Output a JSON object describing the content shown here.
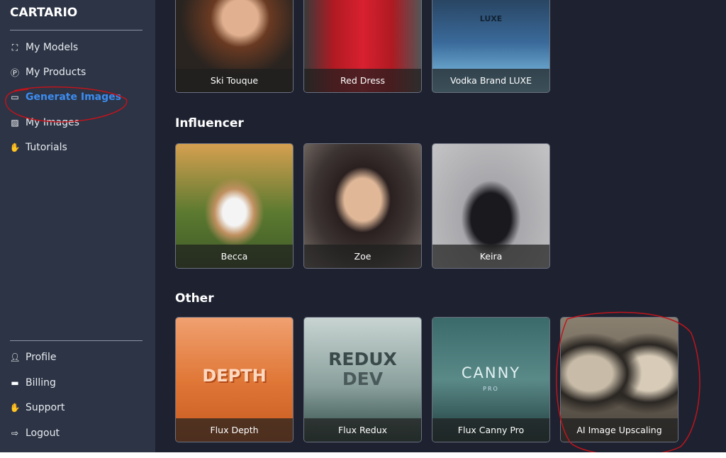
{
  "sidebar": {
    "brand": "CARTARIO",
    "top_items": [
      {
        "label": "My Models",
        "icon": "sitemap-icon"
      },
      {
        "label": "My Products",
        "icon": "product-p-icon"
      },
      {
        "label": "Generate Images",
        "icon": "laptop-icon",
        "active": true
      },
      {
        "label": "My Images",
        "icon": "image-icon"
      },
      {
        "label": "Tutorials",
        "icon": "handshake-icon"
      }
    ],
    "bottom_items": [
      {
        "label": "Profile",
        "icon": "user-icon"
      },
      {
        "label": "Billing",
        "icon": "credit-card-icon"
      },
      {
        "label": "Support",
        "icon": "handshake-icon"
      },
      {
        "label": "Logout",
        "icon": "logout-icon"
      }
    ],
    "accent": "#3d8cf0"
  },
  "sections": [
    {
      "title": "",
      "cards": [
        "Ski Touque",
        "Red Dress",
        "Vodka Brand LUXE"
      ]
    },
    {
      "title": "Influencer",
      "cards": [
        "Becca",
        "Zoe",
        "Keira"
      ]
    },
    {
      "title": "Other",
      "cards": [
        "Flux Depth",
        "Flux Redux",
        "Flux Canny Pro",
        "AI Image Upscaling"
      ]
    }
  ],
  "art_text": {
    "depth": "DEPTH",
    "redux": "REDUX",
    "dev": "DEV",
    "canny": "CANNY",
    "pro": "PRO",
    "luxe": "LUXE"
  },
  "annotation_color": "#c0141c"
}
